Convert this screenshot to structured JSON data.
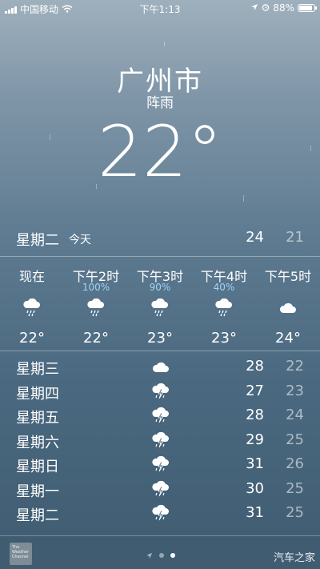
{
  "status_bar": {
    "carrier": "中国移动",
    "time": "下午1:13",
    "battery": "88%",
    "battery_level": 0.88
  },
  "location": {
    "city": "广州市",
    "condition": "阵雨",
    "temperature": "22°"
  },
  "today": {
    "day": "星期二",
    "tag": "今天",
    "high": "24",
    "low": "21"
  },
  "hourly": [
    {
      "label": "现在",
      "precip": "",
      "icon": "cloud-rain-icon",
      "temp": "22°"
    },
    {
      "label": "下午2时",
      "precip": "100%",
      "icon": "cloud-rain-icon",
      "temp": "22°"
    },
    {
      "label": "下午3时",
      "precip": "90%",
      "icon": "cloud-rain-icon",
      "temp": "23°"
    },
    {
      "label": "下午4时",
      "precip": "40%",
      "icon": "cloud-rain-icon",
      "temp": "23°"
    },
    {
      "label": "下午5时",
      "precip": "",
      "icon": "cloud-icon",
      "temp": "24°"
    }
  ],
  "daily": [
    {
      "day": "星期三",
      "icon": "cloud-icon",
      "high": "28",
      "low": "22"
    },
    {
      "day": "星期四",
      "icon": "thunderstorm-icon",
      "high": "27",
      "low": "23"
    },
    {
      "day": "星期五",
      "icon": "thunderstorm-icon",
      "high": "28",
      "low": "24"
    },
    {
      "day": "星期六",
      "icon": "thunderstorm-icon",
      "high": "29",
      "low": "25"
    },
    {
      "day": "星期日",
      "icon": "thunderstorm-icon",
      "high": "31",
      "low": "26"
    },
    {
      "day": "星期一",
      "icon": "thunderstorm-icon",
      "high": "30",
      "low": "25"
    },
    {
      "day": "星期二",
      "icon": "thunderstorm-icon",
      "high": "31",
      "low": "25"
    }
  ],
  "bottom": {
    "logo_text": "The Weather Channel",
    "watermark": "汽车之家"
  },
  "colors": {
    "precip_blue": "#9fd3f5"
  }
}
